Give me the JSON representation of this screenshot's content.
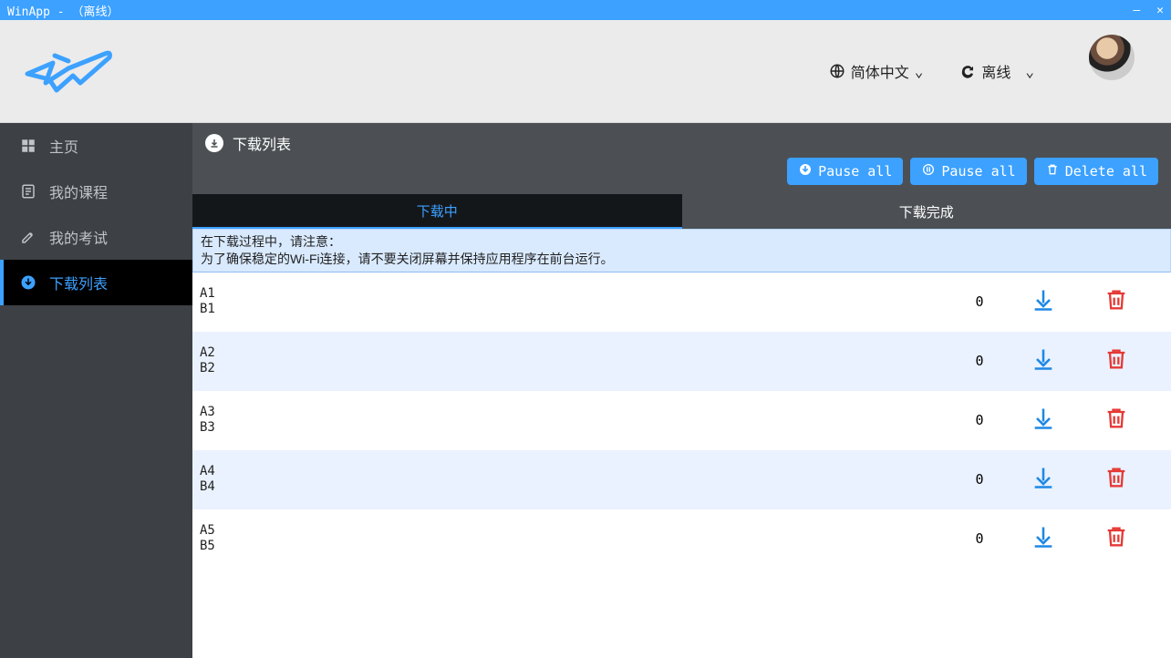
{
  "window": {
    "title": "WinApp - （离线）"
  },
  "header": {
    "language_label": "简体中文",
    "status_label": "离线"
  },
  "sidebar": {
    "items": [
      {
        "label": "主页"
      },
      {
        "label": "我的课程"
      },
      {
        "label": "我的考试"
      },
      {
        "label": "下载列表"
      }
    ]
  },
  "page": {
    "title": "下载列表",
    "buttons": {
      "pause_all_1": "Pause all",
      "pause_all_2": "Pause all",
      "delete_all": "Delete all"
    },
    "tabs": {
      "downloading": "下载中",
      "completed": "下载完成"
    },
    "notice_line1": "在下载过程中，请注意：",
    "notice_line2": "为了确保稳定的Wi-Fi连接，请不要关闭屏幕并保持应用程序在前台运行。"
  },
  "downloads": [
    {
      "line1": "A1",
      "line2": "B1",
      "count": "0"
    },
    {
      "line1": "A2",
      "line2": "B2",
      "count": "0"
    },
    {
      "line1": "A3",
      "line2": "B3",
      "count": "0"
    },
    {
      "line1": "A4",
      "line2": "B4",
      "count": "0"
    },
    {
      "line1": "A5",
      "line2": "B5",
      "count": "0"
    }
  ]
}
